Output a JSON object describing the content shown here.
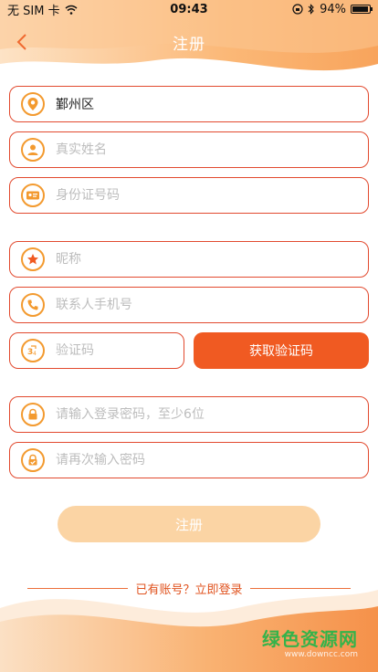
{
  "status_bar": {
    "carrier": "无 SIM 卡",
    "time": "09:43",
    "battery_percent": "94%",
    "battery_level": 0.94
  },
  "nav": {
    "title": "注册",
    "back_icon": "chevron-left-icon"
  },
  "form": {
    "region": {
      "value": "鄞州区",
      "icon": "location-pin-icon"
    },
    "real_name": {
      "placeholder": "真实姓名",
      "icon": "person-icon"
    },
    "id_number": {
      "placeholder": "身份证号码",
      "icon": "id-card-icon"
    },
    "nickname": {
      "placeholder": "昵称",
      "icon": "star-icon"
    },
    "phone": {
      "placeholder": "联系人手机号",
      "icon": "phone-icon"
    },
    "verify_code": {
      "placeholder": "验证码",
      "icon": "code-icon"
    },
    "password": {
      "placeholder": "请输入登录密码，至少6位",
      "icon": "lock-icon"
    },
    "password_confirm": {
      "placeholder": "请再次输入密码",
      "icon": "lock-check-icon"
    }
  },
  "buttons": {
    "get_code": "获取验证码",
    "submit": "注册"
  },
  "footer": {
    "login_prompt": "已有账号？立即登录"
  },
  "watermark": {
    "title": "绿色资源网",
    "url": "www.downcc.com"
  },
  "colors": {
    "accent": "#f05a22",
    "border": "#e24a2f",
    "icon": "#f39a2f",
    "submit_disabled": "#fbd4a4",
    "watermark": "#34b34a"
  }
}
